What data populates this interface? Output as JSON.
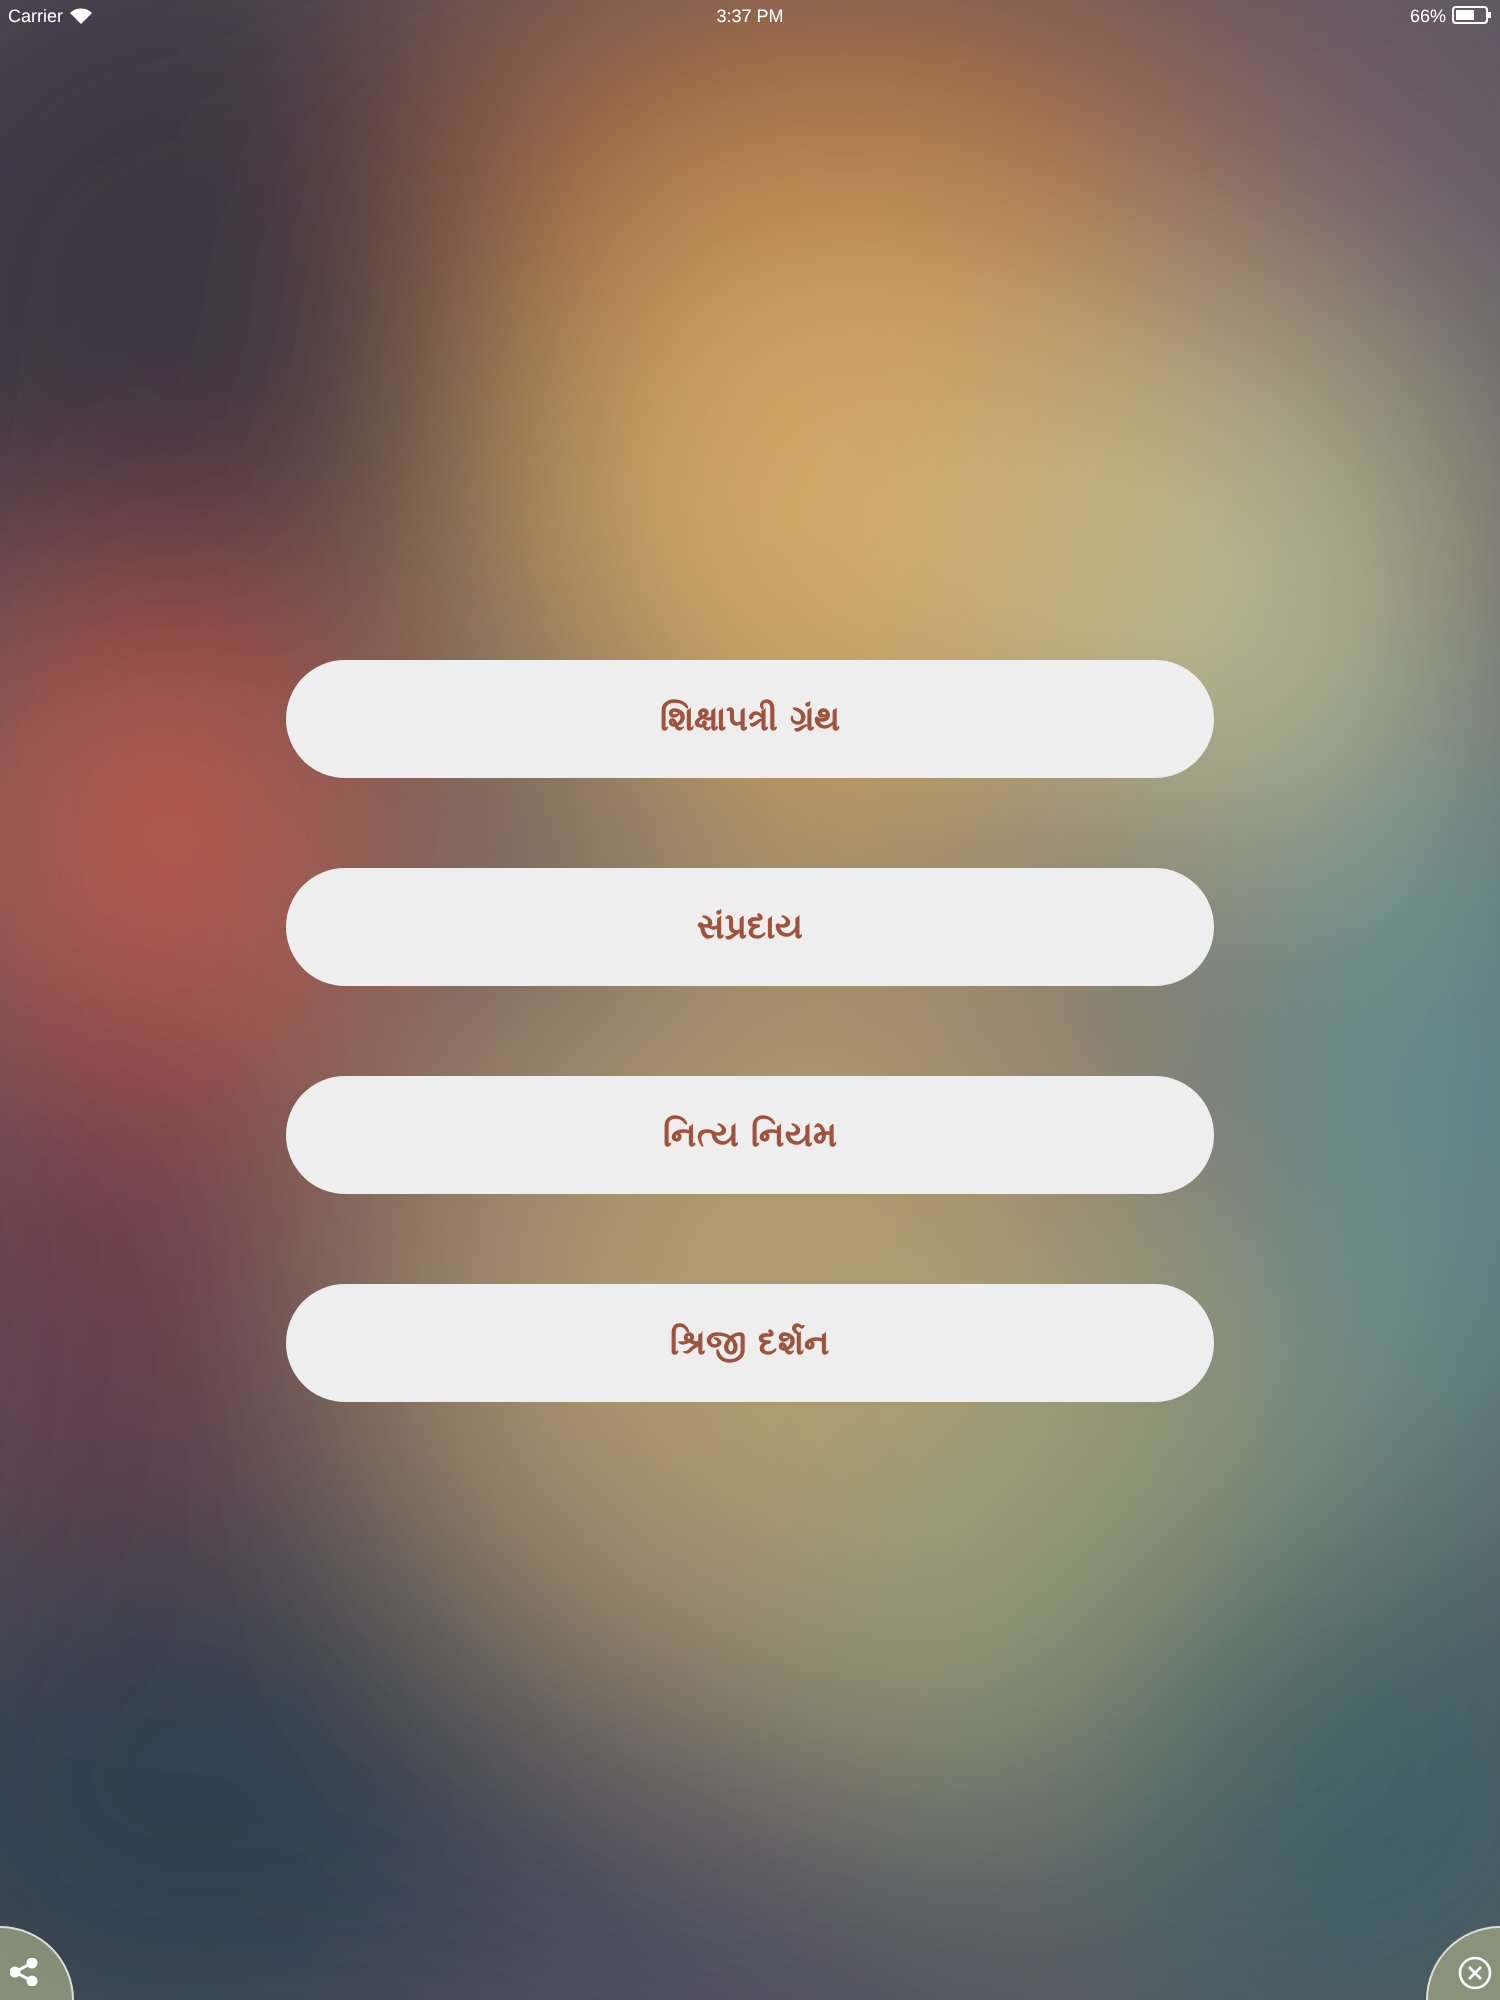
{
  "status_bar": {
    "carrier": "Carrier",
    "time": "3:37 PM",
    "battery": "66%"
  },
  "menu": [
    {
      "label": "શિક્ષાપત્રી ગ્રંથ"
    },
    {
      "label": "સંપ્રદાય"
    },
    {
      "label": "નિત્ય નિયમ"
    },
    {
      "label": "શ્રિજી દર્શન"
    }
  ]
}
